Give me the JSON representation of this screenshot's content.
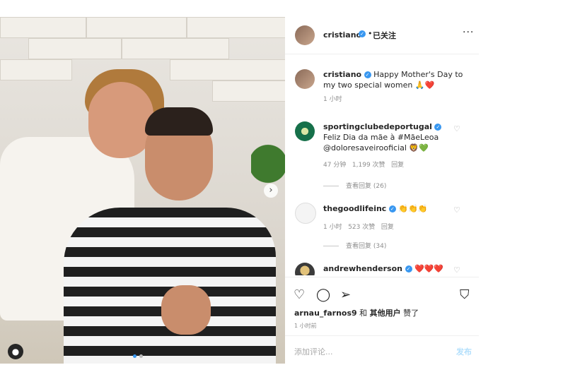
{
  "header": {
    "username": "cristiano",
    "separator": "•",
    "follow_label": "已关注",
    "more_label": "···"
  },
  "caption": {
    "username": "cristiano",
    "text": "Happy Mother's Day to my two special women 🙏❤️",
    "time": "1 小时"
  },
  "comments": [
    {
      "username": "sportingclubedeportugal",
      "text": "Feliz Dia da mãe à #MãeLeoa @doloresaveirooficial 🦁💚",
      "time": "47 分钟",
      "likes": "1,199 次赞",
      "reply": "回复",
      "view_replies": "查看回复 (26)"
    },
    {
      "username": "thegoodlifeinc",
      "text": "👏👏👏",
      "time": "1 小时",
      "likes": "523 次赞",
      "reply": "回复",
      "view_replies": "查看回复 (34)"
    },
    {
      "username": "andrewhenderson",
      "text": "❤️❤️❤️"
    }
  ],
  "actions": {
    "liked_by_user": "arnau_farnos9",
    "liked_by_mid": " 和 ",
    "liked_by_others": "其他用户",
    "liked_by_end": " 赞了",
    "time": "1 小时前"
  },
  "add_comment": {
    "placeholder": "添加评论...",
    "post_label": "发布"
  },
  "icons": [
    "heart-icon",
    "comment-icon",
    "share-icon",
    "bookmark-icon",
    "chevron-right-icon",
    "user-tag-icon"
  ],
  "colors": {
    "verified": "#3897f0",
    "post_button": "#b2dffc",
    "meta_text": "#8e8e8e"
  }
}
